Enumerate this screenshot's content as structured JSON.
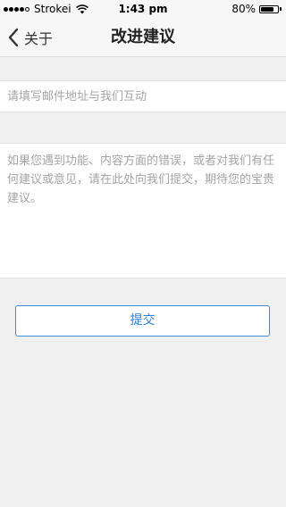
{
  "status_bar": {
    "carrier": "Strokei",
    "time": "1:43 pm",
    "battery_text": "80%",
    "battery_level": 0.8,
    "signal_bars_filled": 4,
    "signal_bars_total": 5
  },
  "nav": {
    "back_label": "关于",
    "title": "改进建议"
  },
  "form": {
    "email_placeholder": "请填写邮件地址与我们互动",
    "feedback_placeholder": "如果您遇到功能、内容方面的错误，或者对我们有任何建议或意见，请在此处向我们提交，期待您的宝贵建议。",
    "submit_label": "提交"
  },
  "colors": {
    "accent": "#2b7fd6",
    "background": "#f0f0f0"
  },
  "icons": {
    "back": "chevron-left-icon",
    "wifi": "wifi-icon",
    "battery": "battery-icon",
    "signal": "signal-dots-icon"
  }
}
